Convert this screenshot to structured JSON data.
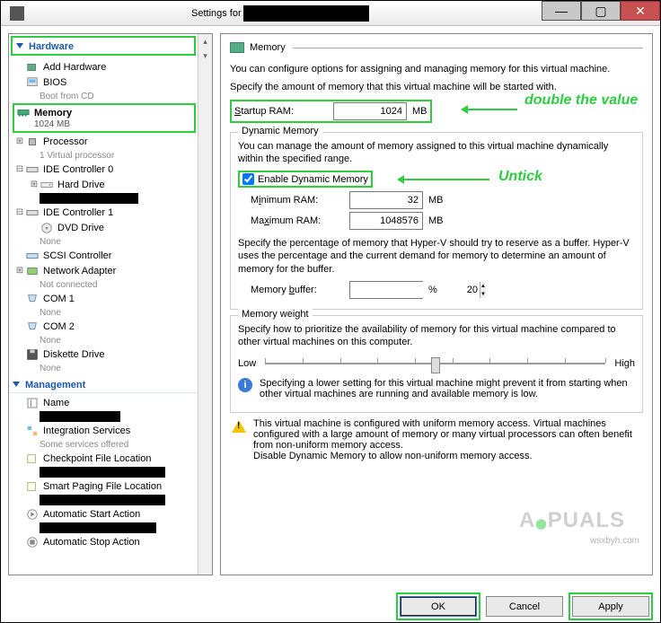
{
  "window": {
    "title": "Settings for",
    "min_ico": "—",
    "max_ico": "▢",
    "close_ico": "✕"
  },
  "sidebar": {
    "section_hardware": "Hardware",
    "section_management": "Management",
    "items": {
      "add_hardware": "Add Hardware",
      "bios": "BIOS",
      "bios_sub": "Boot from CD",
      "memory": "Memory",
      "memory_sub": "1024 MB",
      "processor": "Processor",
      "processor_sub": "1 Virtual processor",
      "ide0": "IDE Controller 0",
      "hard_drive": "Hard Drive",
      "ide1": "IDE Controller 1",
      "dvd": "DVD Drive",
      "dvd_sub": "None",
      "scsi": "SCSI Controller",
      "net": "Network Adapter",
      "net_sub": "Not connected",
      "com1": "COM 1",
      "com1_sub": "None",
      "com2": "COM 2",
      "com2_sub": "None",
      "diskette": "Diskette Drive",
      "diskette_sub": "None",
      "name": "Name",
      "integration": "Integration Services",
      "integration_sub": "Some services offered",
      "checkpoint": "Checkpoint File Location",
      "smartpaging": "Smart Paging File Location",
      "autostart": "Automatic Start Action",
      "autostop": "Automatic Stop Action"
    }
  },
  "memory_panel": {
    "header": "Memory",
    "intro": "You can configure options for assigning and managing memory for this virtual machine.",
    "startup_desc": "Specify the amount of memory that this virtual machine will be started with.",
    "startup_label": "Startup RAM:",
    "startup_value": "1024",
    "mb": "MB",
    "dynamic_title": "Dynamic Memory",
    "dynamic_desc": "You can manage the amount of memory assigned to this virtual machine dynamically within the specified range.",
    "enable_dynamic": "Enable Dynamic Memory",
    "min_label": "Minimum RAM:",
    "min_value": "32",
    "max_label": "Maximum RAM:",
    "max_value": "1048576",
    "buffer_desc": "Specify the percentage of memory that Hyper-V should try to reserve as a buffer. Hyper-V uses the percentage and the current demand for memory to determine an amount of memory for the buffer.",
    "buffer_label": "Memory buffer:",
    "buffer_value": "20",
    "percent": "%",
    "weight_title": "Memory weight",
    "weight_desc": "Specify how to prioritize the availability of memory for this virtual machine compared to other virtual machines on this computer.",
    "low": "Low",
    "high": "High",
    "info_text": "Specifying a lower setting for this virtual machine might prevent it from starting when other virtual machines are running and available memory is low.",
    "warn_text": "This virtual machine is configured with uniform memory access. Virtual machines configured with a large amount of memory or many virtual processors can often benefit from non-uniform memory access.\nDisable Dynamic Memory to allow non-uniform memory access."
  },
  "annotations": {
    "double": "double the value",
    "untick": "Untick"
  },
  "buttons": {
    "ok": "OK",
    "cancel": "Cancel",
    "apply": "Apply"
  },
  "watermark": {
    "text": "A PUALS",
    "sub": "wsxbyh.com"
  }
}
